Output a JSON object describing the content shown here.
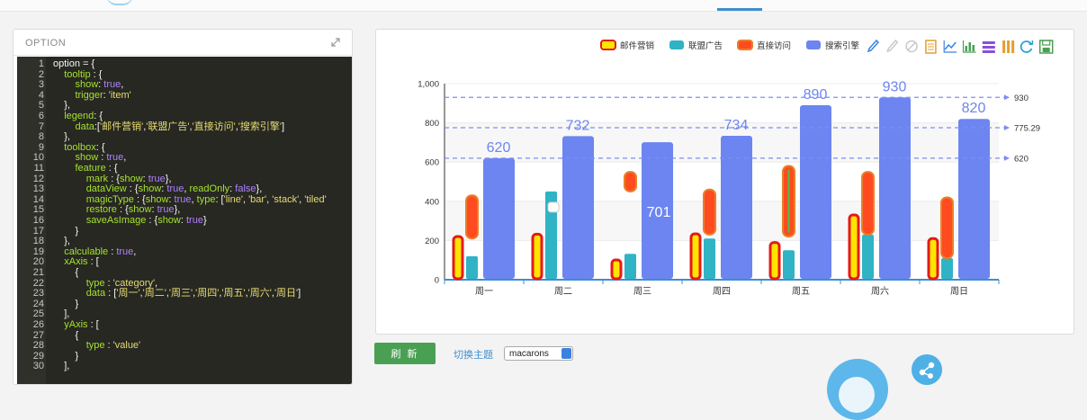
{
  "editor": {
    "title": "OPTION",
    "lines": [
      [
        [
          "option = {",
          "p"
        ]
      ],
      [
        [
          "    ",
          "p"
        ],
        [
          "tooltip",
          "id"
        ],
        [
          " : {",
          "p"
        ]
      ],
      [
        [
          "        ",
          "p"
        ],
        [
          "show",
          "id"
        ],
        [
          ": ",
          "p"
        ],
        [
          "true",
          "kw"
        ],
        [
          ",",
          "p"
        ]
      ],
      [
        [
          "        ",
          "p"
        ],
        [
          "trigger",
          "id"
        ],
        [
          ": ",
          "p"
        ],
        [
          "'item'",
          "str"
        ]
      ],
      [
        [
          "    },",
          "p"
        ]
      ],
      [
        [
          "    ",
          "p"
        ],
        [
          "legend",
          "id"
        ],
        [
          ": {",
          "p"
        ]
      ],
      [
        [
          "        ",
          "p"
        ],
        [
          "data",
          "id"
        ],
        [
          ":[",
          "p"
        ],
        [
          "'邮件营销'",
          "str"
        ],
        [
          ",",
          "p"
        ],
        [
          "'联盟广告'",
          "str"
        ],
        [
          ",",
          "p"
        ],
        [
          "'直接访问'",
          "str"
        ],
        [
          ",",
          "p"
        ],
        [
          "'搜索引擎'",
          "str"
        ],
        [
          "]",
          "p"
        ]
      ],
      [
        [
          "    },",
          "p"
        ]
      ],
      [
        [
          "    ",
          "p"
        ],
        [
          "toolbox",
          "id"
        ],
        [
          ": {",
          "p"
        ]
      ],
      [
        [
          "        ",
          "p"
        ],
        [
          "show",
          "id"
        ],
        [
          " : ",
          "p"
        ],
        [
          "true",
          "kw"
        ],
        [
          ",",
          "p"
        ]
      ],
      [
        [
          "        ",
          "p"
        ],
        [
          "feature",
          "id"
        ],
        [
          " : {",
          "p"
        ]
      ],
      [
        [
          "            ",
          "p"
        ],
        [
          "mark",
          "id"
        ],
        [
          " : {",
          "p"
        ],
        [
          "show",
          "id"
        ],
        [
          ": ",
          "p"
        ],
        [
          "true",
          "kw"
        ],
        [
          "},",
          "p"
        ]
      ],
      [
        [
          "            ",
          "p"
        ],
        [
          "dataView",
          "id"
        ],
        [
          " : {",
          "p"
        ],
        [
          "show",
          "id"
        ],
        [
          ": ",
          "p"
        ],
        [
          "true",
          "kw"
        ],
        [
          ", ",
          "p"
        ],
        [
          "readOnly",
          "id"
        ],
        [
          ": ",
          "p"
        ],
        [
          "false",
          "kw"
        ],
        [
          "},",
          "p"
        ]
      ],
      [
        [
          "            ",
          "p"
        ],
        [
          "magicType",
          "id"
        ],
        [
          " : {",
          "p"
        ],
        [
          "show",
          "id"
        ],
        [
          ": ",
          "p"
        ],
        [
          "true",
          "kw"
        ],
        [
          ", ",
          "p"
        ],
        [
          "type",
          "id"
        ],
        [
          ": [",
          "p"
        ],
        [
          "'line'",
          "str"
        ],
        [
          ", ",
          "p"
        ],
        [
          "'bar'",
          "str"
        ],
        [
          ", ",
          "p"
        ],
        [
          "'stack'",
          "str"
        ],
        [
          ", ",
          "p"
        ],
        [
          "'tiled'",
          "str"
        ]
      ],
      [
        [
          "            ",
          "p"
        ],
        [
          "restore",
          "id"
        ],
        [
          " : {",
          "p"
        ],
        [
          "show",
          "id"
        ],
        [
          ": ",
          "p"
        ],
        [
          "true",
          "kw"
        ],
        [
          "},",
          "p"
        ]
      ],
      [
        [
          "            ",
          "p"
        ],
        [
          "saveAsImage",
          "id"
        ],
        [
          " : {",
          "p"
        ],
        [
          "show",
          "id"
        ],
        [
          ": ",
          "p"
        ],
        [
          "true",
          "kw"
        ],
        [
          "}",
          "p"
        ]
      ],
      [
        [
          "        }",
          "p"
        ]
      ],
      [
        [
          "    },",
          "p"
        ]
      ],
      [
        [
          "    ",
          "p"
        ],
        [
          "calculable",
          "id"
        ],
        [
          " : ",
          "p"
        ],
        [
          "true",
          "kw"
        ],
        [
          ",",
          "p"
        ]
      ],
      [
        [
          "    ",
          "p"
        ],
        [
          "xAxis",
          "id"
        ],
        [
          " : [",
          "p"
        ]
      ],
      [
        [
          "        {",
          "p"
        ]
      ],
      [
        [
          "            ",
          "p"
        ],
        [
          "type",
          "id"
        ],
        [
          " : ",
          "p"
        ],
        [
          "'category'",
          "str"
        ],
        [
          ",",
          "p"
        ]
      ],
      [
        [
          "            ",
          "p"
        ],
        [
          "data",
          "id"
        ],
        [
          " : [",
          "p"
        ],
        [
          "'周一'",
          "str"
        ],
        [
          ",",
          "p"
        ],
        [
          "'周二'",
          "str"
        ],
        [
          ",",
          "p"
        ],
        [
          "'周三'",
          "str"
        ],
        [
          ",",
          "p"
        ],
        [
          "'周四'",
          "str"
        ],
        [
          ",",
          "p"
        ],
        [
          "'周五'",
          "str"
        ],
        [
          ",",
          "p"
        ],
        [
          "'周六'",
          "str"
        ],
        [
          ",",
          "p"
        ],
        [
          "'周日'",
          "str"
        ],
        [
          "]",
          "p"
        ]
      ],
      [
        [
          "        }",
          "p"
        ]
      ],
      [
        [
          "    ],",
          "p"
        ]
      ],
      [
        [
          "    ",
          "p"
        ],
        [
          "yAxis",
          "id"
        ],
        [
          " : [",
          "p"
        ]
      ],
      [
        [
          "        {",
          "p"
        ]
      ],
      [
        [
          "            ",
          "p"
        ],
        [
          "type",
          "id"
        ],
        [
          " : ",
          "p"
        ],
        [
          "'value'",
          "str"
        ]
      ],
      [
        [
          "        }",
          "p"
        ]
      ],
      [
        [
          "    ],",
          "p"
        ]
      ]
    ]
  },
  "chart_data": {
    "type": "bar",
    "categories": [
      "周一",
      "周二",
      "周三",
      "周四",
      "周五",
      "周六",
      "周日"
    ],
    "ylim": [
      0,
      1000
    ],
    "yticks": [
      "0",
      "200",
      "400",
      "600",
      "800",
      "1,000"
    ],
    "series": [
      {
        "name": "邮件营销",
        "values": [
          220,
          232,
          101,
          234,
          190,
          330,
          210
        ],
        "color": "#ffe400",
        "border": "#e51a1a"
      },
      {
        "name": "联盟广告",
        "values": [
          120,
          450,
          132,
          210,
          150,
          230,
          110
        ],
        "color": "#2fb3c5",
        "border": ""
      },
      {
        "name": "直接访问",
        "values": [
          [
            210,
            430
          ],
          [
            330,
            320
          ],
          [
            450,
            550
          ],
          [
            230,
            460
          ],
          [
            220,
            580
          ],
          [
            230,
            550
          ],
          [
            110,
            420
          ]
        ],
        "color": "#ff4b1f",
        "border": "#e9802a"
      },
      {
        "name": "搜索引擎",
        "values": [
          620,
          732,
          701,
          734,
          890,
          930,
          820
        ],
        "color": "#6c85f0",
        "border": ""
      }
    ],
    "labels": {
      "邮件营销": [],
      "联盟广告": [],
      "直接访问": [],
      "搜索引擎": [
        "620",
        "732",
        "701",
        "734",
        "890",
        "930",
        "820"
      ]
    },
    "mark_lines": [
      {
        "value": 930,
        "label": "930"
      },
      {
        "value": 775.29,
        "label": "775.29"
      },
      {
        "value": 620,
        "label": "620"
      }
    ],
    "grid": true,
    "legend_position": "top-right"
  },
  "toolbox": {
    "icons": [
      "mark-icon",
      "mark-undo-icon",
      "mark-clear-icon",
      "data-view-icon",
      "line-chart-icon",
      "bar-chart-icon",
      "stack-icon",
      "tiled-icon",
      "restore-icon",
      "save-image-icon"
    ]
  },
  "controls": {
    "refresh_label": "刷 新",
    "theme_label": "切换主题",
    "theme_value": "macarons"
  },
  "colors": {
    "accent": "#3d8fd0",
    "refresh": "#4aa052",
    "mark_line": "#7f8df6"
  }
}
